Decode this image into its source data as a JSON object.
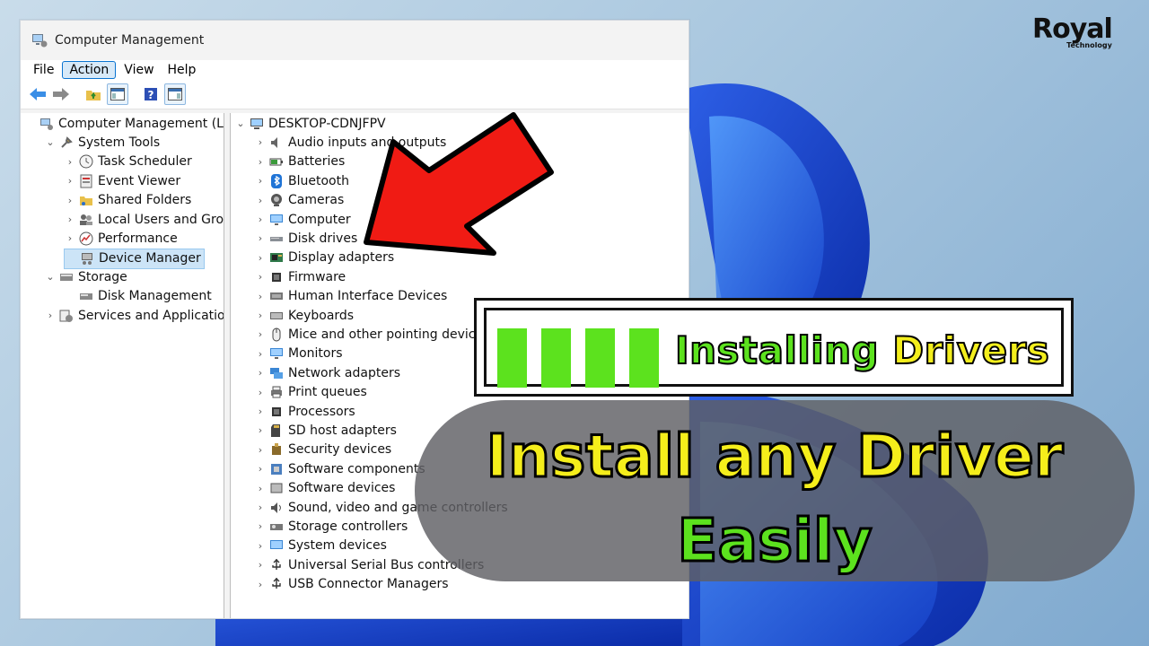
{
  "window": {
    "title": "Computer Management",
    "menu": [
      "File",
      "Action",
      "View",
      "Help"
    ],
    "active_menu_index": 1
  },
  "left_tree": [
    {
      "label": "Computer Management (Local",
      "icon": "computer-management-icon",
      "level": 0,
      "chevron": ""
    },
    {
      "label": "System Tools",
      "icon": "tools-icon",
      "level": 1,
      "chevron": "v"
    },
    {
      "label": "Task Scheduler",
      "icon": "clock-icon",
      "level": 2,
      "chevron": ">"
    },
    {
      "label": "Event Viewer",
      "icon": "event-viewer-icon",
      "level": 2,
      "chevron": ">"
    },
    {
      "label": "Shared Folders",
      "icon": "shared-folder-icon",
      "level": 2,
      "chevron": ">"
    },
    {
      "label": "Local Users and Groups",
      "icon": "users-icon",
      "level": 2,
      "chevron": ">"
    },
    {
      "label": "Performance",
      "icon": "performance-icon",
      "level": 2,
      "chevron": ">"
    },
    {
      "label": "Device Manager",
      "icon": "device-manager-icon",
      "level": 2,
      "chevron": "",
      "selected": true
    },
    {
      "label": "Storage",
      "icon": "storage-icon",
      "level": 1,
      "chevron": "v"
    },
    {
      "label": "Disk Management",
      "icon": "disk-management-icon",
      "level": 2,
      "chevron": ""
    },
    {
      "label": "Services and Applications",
      "icon": "services-icon",
      "level": 1,
      "chevron": ">"
    }
  ],
  "device_tree": {
    "root": "DESKTOP-CDNJFPV",
    "categories": [
      {
        "label": "Audio inputs and outputs",
        "icon": "speaker-icon"
      },
      {
        "label": "Batteries",
        "icon": "battery-icon"
      },
      {
        "label": "Bluetooth",
        "icon": "bluetooth-icon"
      },
      {
        "label": "Cameras",
        "icon": "camera-icon"
      },
      {
        "label": "Computer",
        "icon": "monitor-icon"
      },
      {
        "label": "Disk drives",
        "icon": "disk-drive-icon"
      },
      {
        "label": "Display adapters",
        "icon": "display-adapter-icon"
      },
      {
        "label": "Firmware",
        "icon": "chip-icon"
      },
      {
        "label": "Human Interface Devices",
        "icon": "hid-icon"
      },
      {
        "label": "Keyboards",
        "icon": "keyboard-icon"
      },
      {
        "label": "Mice and other pointing device",
        "icon": "mouse-icon"
      },
      {
        "label": "Monitors",
        "icon": "monitor-icon"
      },
      {
        "label": "Network adapters",
        "icon": "network-icon"
      },
      {
        "label": "Print queues",
        "icon": "printer-icon"
      },
      {
        "label": "Processors",
        "icon": "chip-icon"
      },
      {
        "label": "SD host adapters",
        "icon": "sd-card-icon"
      },
      {
        "label": "Security devices",
        "icon": "security-icon"
      },
      {
        "label": "Software components",
        "icon": "software-component-icon"
      },
      {
        "label": "Software devices",
        "icon": "software-device-icon"
      },
      {
        "label": "Sound, video and game controllers",
        "icon": "sound-icon"
      },
      {
        "label": "Storage controllers",
        "icon": "storage-controller-icon"
      },
      {
        "label": "System devices",
        "icon": "system-devices-icon"
      },
      {
        "label": "Universal Serial Bus controllers",
        "icon": "usb-icon"
      },
      {
        "label": "USB Connector Managers",
        "icon": "usb-icon"
      }
    ]
  },
  "overlay": {
    "banner_text_green": "Installing ",
    "banner_text_yellow": "Drivers",
    "headline_line1": "Install any Driver",
    "headline_line2": "Easily",
    "logo_main": "Royal",
    "logo_sub": "Technology"
  },
  "colors": {
    "accent_green": "#5ce21e",
    "accent_yellow": "#f3ee1d",
    "arrow_red": "#f01b14",
    "selection": "#cce4f7"
  }
}
